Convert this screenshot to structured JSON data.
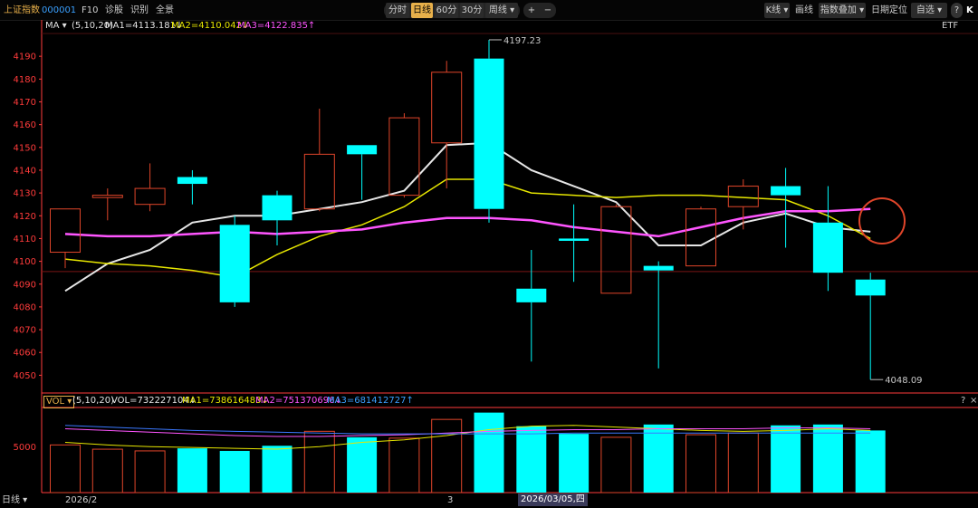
{
  "toolbar": {
    "index_name": "上证指数",
    "code": "000001",
    "f10": "F10",
    "diagnose": "诊股",
    "identify": "识别",
    "market": "全景",
    "tabs": [
      "分时",
      "日线",
      "60分",
      "30分"
    ],
    "active_tab": "日线",
    "period": "周线 ▾",
    "zoom_in": "+",
    "zoom_out": "−",
    "k_line": "K线 ▾",
    "draw": "画线",
    "index_overlay": "指数叠加 ▾",
    "date_locate": "日期定位",
    "watchlist": "自选 ▾",
    "help": "?",
    "logo": "K"
  },
  "ma_info": {
    "label": "MA ▾",
    "params": "(5,10,20)",
    "ma1": "MA1=4113.181↓",
    "ma2": "MA2=4110.042↓",
    "ma3": "MA3=4122.835↑",
    "etf": "ETF"
  },
  "vol_info": {
    "label": "VOL ▾",
    "params": "(5,10,20)",
    "vol": "VOL=732227104↓",
    "ma1": "MA1=738616483↓",
    "ma2": "MA2=751370696↓",
    "ma3": "MA3=681412727↑",
    "help": "?",
    "close": "×"
  },
  "bottom": {
    "period_label": "日线 ▾",
    "month_label": "2026/2",
    "day_label": "3",
    "cursor_date": "2026/03/05,四"
  },
  "colors": {
    "up": "#e0452a",
    "down": "#00ffff",
    "ma1": "#e6e6e6",
    "ma2": "#e6e600",
    "ma3": "#ff55ff",
    "axis": "#ff3b3b",
    "highlight": "#e0452a"
  },
  "chart_data": [
    {
      "type": "candlestick",
      "title": "",
      "ylim": [
        4043,
        4200
      ],
      "yticks": [
        4050,
        4060,
        4070,
        4080,
        4090,
        4100,
        4110,
        4120,
        4130,
        4140,
        4150,
        4160,
        4170,
        4180,
        4190
      ],
      "max_label": "4197.23",
      "min_label": "4048.09",
      "max_value": 4197.23,
      "min_value": 4048.09,
      "candles": [
        {
          "open": 4104,
          "close": 4123,
          "high": 4123,
          "low": 4097
        },
        {
          "open": 4128,
          "close": 4129,
          "high": 4132,
          "low": 4118
        },
        {
          "open": 4125,
          "close": 4132,
          "high": 4143,
          "low": 4122
        },
        {
          "open": 4137,
          "close": 4134,
          "high": 4140,
          "low": 4125
        },
        {
          "open": 4116,
          "close": 4082,
          "high": 4120,
          "low": 4080
        },
        {
          "open": 4129,
          "close": 4118,
          "high": 4131,
          "low": 4107
        },
        {
          "open": 4123,
          "close": 4147,
          "high": 4167,
          "low": 4122
        },
        {
          "open": 4151,
          "close": 4147,
          "high": 4151,
          "low": 4127
        },
        {
          "open": 4129,
          "close": 4163,
          "high": 4165,
          "low": 4128
        },
        {
          "open": 4152,
          "close": 4183,
          "high": 4188,
          "low": 4132
        },
        {
          "open": 4189,
          "close": 4123,
          "high": 4197.23,
          "low": 4117
        },
        {
          "open": 4088,
          "close": 4082,
          "high": 4105,
          "low": 4056
        },
        {
          "open": 4110,
          "close": 4109,
          "high": 4125,
          "low": 4091
        },
        {
          "open": 4086,
          "close": 4124,
          "high": 4125,
          "low": 4086
        },
        {
          "open": 4098,
          "close": 4096,
          "high": 4100,
          "low": 4053
        },
        {
          "open": 4098,
          "close": 4123,
          "high": 4124,
          "low": 4098
        },
        {
          "open": 4124,
          "close": 4133,
          "high": 4136,
          "low": 4114
        },
        {
          "open": 4133,
          "close": 4129,
          "high": 4141,
          "low": 4106
        },
        {
          "open": 4117,
          "close": 4095,
          "high": 4133,
          "low": 4087
        },
        {
          "open": 4092,
          "close": 4085,
          "high": 4095,
          "low": 4048.09
        }
      ],
      "ma_lines": [
        {
          "name": "MA1",
          "values": [
            4087,
            4099,
            4105,
            4117,
            4120,
            4120,
            4123,
            4126,
            4131,
            4151,
            4152,
            4140,
            4133,
            4126,
            4107,
            4107,
            4117,
            4121,
            4115,
            4113
          ]
        },
        {
          "name": "MA2",
          "values": [
            4101,
            4099,
            4098,
            4096,
            4093,
            4103,
            4111,
            4116,
            4124,
            4136,
            4136,
            4130,
            4129,
            4128,
            4129,
            4129,
            4128,
            4127,
            4120,
            4110
          ]
        },
        {
          "name": "MA3",
          "values": [
            4112,
            4111,
            4111,
            4112,
            4113,
            4112,
            4113,
            4114,
            4117,
            4119,
            4119,
            4118,
            4115,
            4113,
            4111,
            4115,
            4119,
            4122,
            4122,
            4123
          ]
        }
      ]
    },
    {
      "type": "bar",
      "title": "",
      "ytick_label": "5000",
      "ylim": [
        0,
        10
      ],
      "values": [
        5.6,
        5.1,
        4.9,
        5.2,
        4.9,
        5.5,
        7.2,
        6.5,
        6.4,
        8.6,
        9.4,
        7.8,
        6.9,
        6.5,
        8.0,
        6.8,
        7.0,
        7.9,
        8.0,
        7.3
      ],
      "directions": [
        "up",
        "up",
        "up",
        "down",
        "down",
        "down",
        "up",
        "down",
        "up",
        "up",
        "down",
        "down",
        "down",
        "up",
        "down",
        "up",
        "up",
        "down",
        "down",
        "down"
      ],
      "ma_lines": [
        {
          "name": "MA1",
          "values": [
            5.9,
            5.6,
            5.4,
            5.3,
            5.2,
            5.1,
            5.4,
            5.9,
            6.2,
            6.7,
            7.4,
            7.8,
            7.9,
            7.7,
            7.5,
            7.3,
            7.2,
            7.3,
            7.5,
            7.3
          ]
        },
        {
          "name": "MA2",
          "values": [
            7.5,
            7.3,
            7.1,
            6.9,
            6.7,
            6.6,
            6.6,
            6.7,
            6.8,
            7.0,
            7.2,
            7.3,
            7.4,
            7.4,
            7.5,
            7.5,
            7.5,
            7.6,
            7.6,
            7.5
          ]
        },
        {
          "name": "MA3",
          "values": [
            7.9,
            7.7,
            7.5,
            7.3,
            7.2,
            7.1,
            7.0,
            6.9,
            6.9,
            6.9,
            6.9,
            6.9,
            7.0,
            7.0,
            7.0,
            7.0,
            7.0,
            7.0,
            7.0,
            7.0
          ]
        }
      ]
    }
  ]
}
